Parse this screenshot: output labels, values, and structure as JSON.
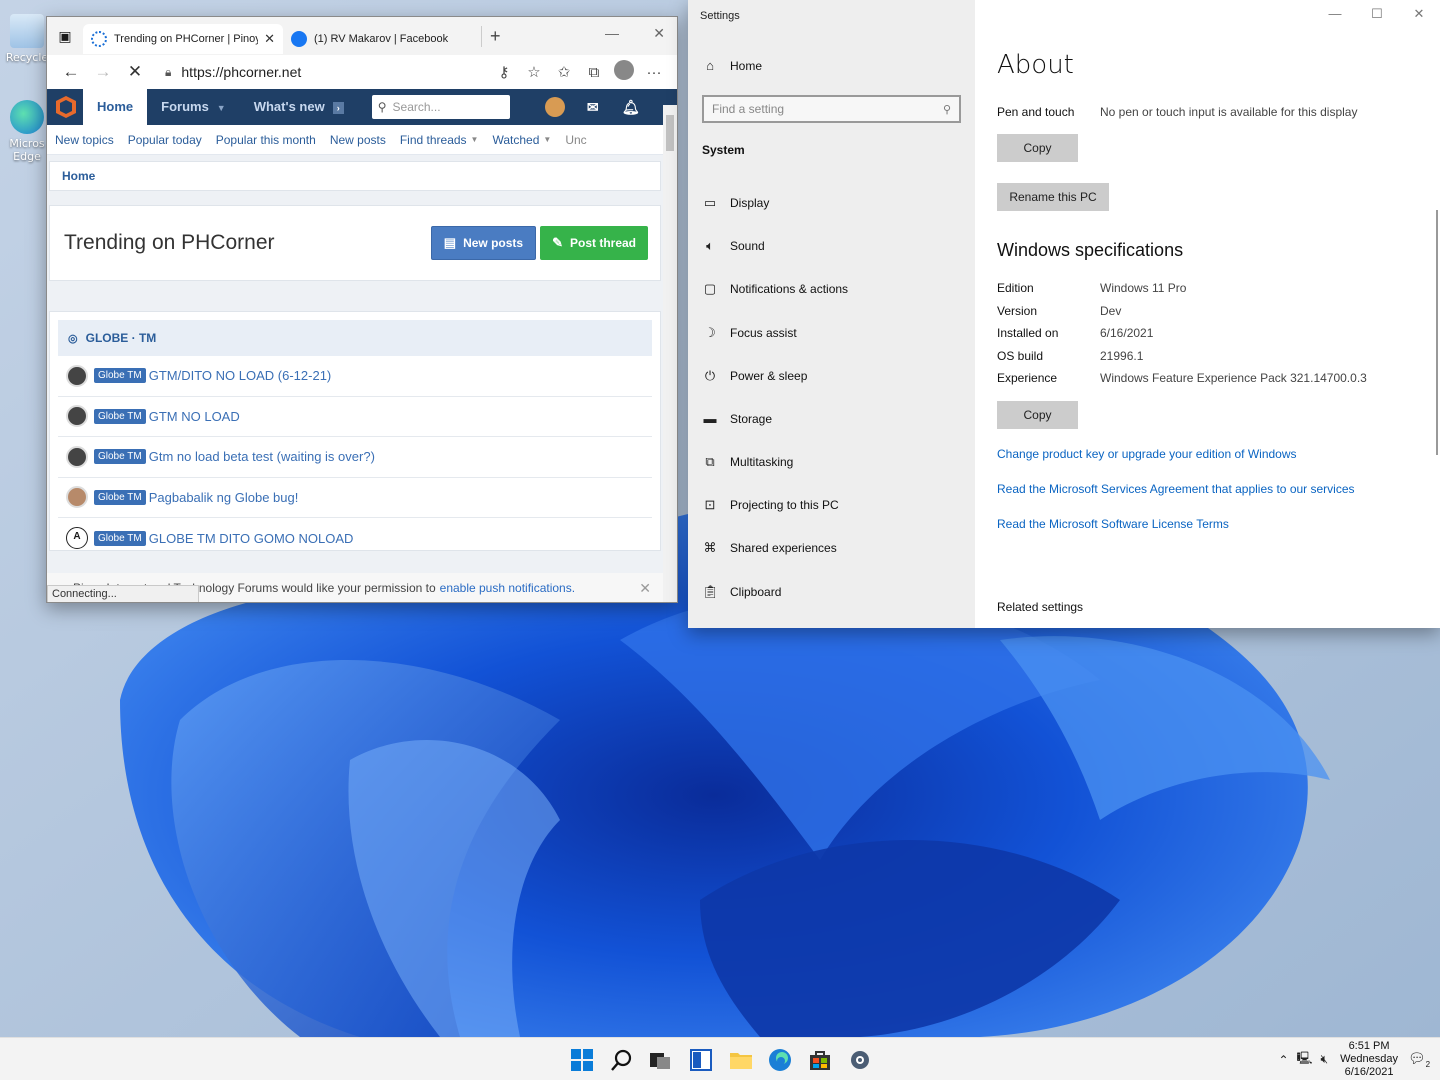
{
  "desktop": {
    "icons": [
      {
        "label": "Recycle",
        "name": "recycle-bin"
      },
      {
        "label": "Micros Edge",
        "name": "edge-shortcut"
      }
    ]
  },
  "browser": {
    "tabs": [
      {
        "title": "Trending on PHCorner | Pinoy",
        "active": true
      },
      {
        "title": "(1) RV Makarov | Facebook",
        "active": false
      }
    ],
    "new_tab": "+",
    "url": "https://phcorner.net",
    "site": {
      "nav": [
        {
          "label": "Home",
          "active": true
        },
        {
          "label": "Forums",
          "caret": true
        },
        {
          "label": "What's new",
          "caret": true
        }
      ],
      "search_placeholder": "Search...",
      "subnav": [
        "New topics",
        "Popular today",
        "Popular this month",
        "New posts",
        "Find threads",
        "Watched",
        "Unc"
      ],
      "breadcrumb": "Home",
      "page_title": "Trending on PHCorner",
      "btn_new_posts": "New posts",
      "btn_post_thread": "Post thread",
      "section": "GLOBE · TM",
      "threads": [
        {
          "badge": "Globe TM",
          "title": "GTM/DITO NO LOAD (6-12-21)"
        },
        {
          "badge": "Globe TM",
          "title": "GTM NO LOAD"
        },
        {
          "badge": "Globe TM",
          "title": "Gtm no load beta test (waiting is over?)"
        },
        {
          "badge": "Globe TM",
          "title": "Pagbabalik ng Globe bug!"
        },
        {
          "badge": "Globe TM",
          "title": "GLOBE TM DITO GOMO NOLOAD"
        }
      ],
      "notice_text": "Pinoy Internet and Technology Forums would like your permission to",
      "notice_link": "enable push notifications.",
      "status": "Connecting..."
    }
  },
  "settings": {
    "app_title": "Settings",
    "home": "Home",
    "search_placeholder": "Find a setting",
    "section": "System",
    "nav": [
      {
        "label": "Display",
        "icon": "monitor-icon"
      },
      {
        "label": "Sound",
        "icon": "speaker-icon"
      },
      {
        "label": "Notifications & actions",
        "icon": "message-icon"
      },
      {
        "label": "Focus assist",
        "icon": "moon-icon"
      },
      {
        "label": "Power & sleep",
        "icon": "power-icon"
      },
      {
        "label": "Storage",
        "icon": "storage-icon"
      },
      {
        "label": "Multitasking",
        "icon": "multitasking-icon"
      },
      {
        "label": "Projecting to this PC",
        "icon": "projector-icon"
      },
      {
        "label": "Shared experiences",
        "icon": "shared-icon"
      },
      {
        "label": "Clipboard",
        "icon": "clipboard-icon"
      }
    ],
    "about_title": "About",
    "pen_label": "Pen and touch",
    "pen_value": "No pen or touch input is available for this display",
    "copy1": "Copy",
    "rename": "Rename this PC",
    "winspec_title": "Windows specifications",
    "specs": [
      {
        "k": "Edition",
        "v": "Windows 11 Pro"
      },
      {
        "k": "Version",
        "v": "Dev"
      },
      {
        "k": "Installed on",
        "v": "6/16/2021"
      },
      {
        "k": "OS build",
        "v": "21996.1"
      },
      {
        "k": "Experience",
        "v": "Windows Feature Experience Pack 321.14700.0.3"
      }
    ],
    "copy2": "Copy",
    "links": [
      "Change product key or upgrade your edition of Windows",
      "Read the Microsoft Services Agreement that applies to our services",
      "Read the Microsoft Software License Terms"
    ],
    "related": "Related settings"
  },
  "taskbar": {
    "time": "6:51 PM",
    "day": "Wednesday",
    "date": "6/16/2021",
    "notifications": "2"
  },
  "colors": {
    "site_nav": "#1f3f66",
    "link_blue": "#0a64c2",
    "badge_blue": "#3a6fb5",
    "post_green": "#36b34a"
  }
}
